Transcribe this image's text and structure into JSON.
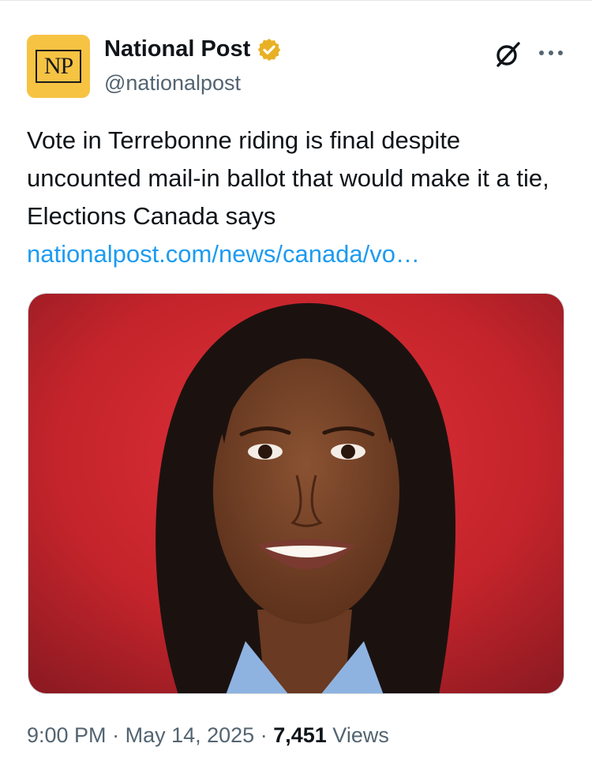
{
  "account": {
    "display_name": "National Post",
    "handle": "@nationalpost",
    "avatar_text": "NP",
    "avatar_color": "#f6c343",
    "verified_color": "#e8b124"
  },
  "tweet": {
    "text": "Vote in Terrebonne riding is final despite uncounted mail-in ballot that would make it a tie, Elections Canada says",
    "link": "nationalpost.com/news/canada/vo…",
    "link_color": "#1d9bf0"
  },
  "media": {
    "background_color": "#c4242b"
  },
  "meta": {
    "time": "9:00 PM",
    "date": "May 14, 2025",
    "views_count": "7,451",
    "views_label": "Views"
  },
  "icons": {
    "grok": "grok-icon",
    "more": "more-icon",
    "verified": "verified-badge-icon"
  }
}
